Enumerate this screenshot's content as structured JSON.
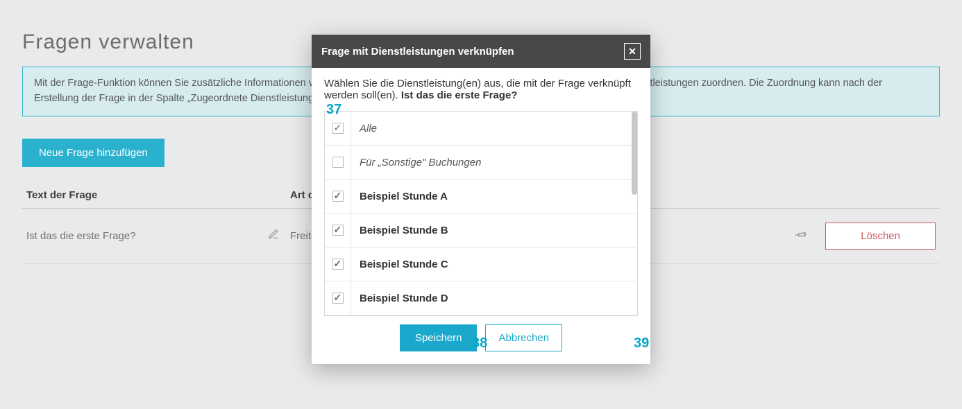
{
  "page": {
    "title": "Fragen verwalten",
    "info": "Mit der Frage-Funktion können Sie zusätzliche Informationen von Ihren Kunden abfragen. Dabei können Sie jede Frage bestimmten Dienstleistungen zuordnen. Die Zuordnung kann nach der Erstellung der Frage in der Spalte „Zugeordnete Dienstleistungen\" eingesehen und verändert werden.",
    "add_button": "Neue Frage hinzufügen",
    "columns": {
      "text": "Text der Frage",
      "type": "Art der Frage"
    },
    "rows": [
      {
        "text": "Ist das die erste Frage?",
        "type": "Freitext",
        "delete": "Löschen"
      }
    ]
  },
  "modal": {
    "title": "Frage mit Dienstleistungen verknüpfen",
    "instruction": "Wählen Sie die Dienstleistung(en) aus, die mit der Frage verknüpft werden soll(en). ",
    "instruction_bold": "Ist das die erste Frage?",
    "services": [
      {
        "label": "Alle",
        "checked": true,
        "style": "italic"
      },
      {
        "label": "Für „Sonstige\" Buchungen",
        "checked": false,
        "style": "italic"
      },
      {
        "label": "Beispiel Stunde A",
        "checked": true,
        "style": "bold"
      },
      {
        "label": "Beispiel Stunde B",
        "checked": true,
        "style": "bold"
      },
      {
        "label": "Beispiel Stunde C",
        "checked": true,
        "style": "bold"
      },
      {
        "label": "Beispiel Stunde D",
        "checked": true,
        "style": "bold"
      }
    ],
    "save": "Speichern",
    "cancel": "Abbrechen"
  },
  "annotations": {
    "a37": "37",
    "a38": "38",
    "a39": "39"
  }
}
